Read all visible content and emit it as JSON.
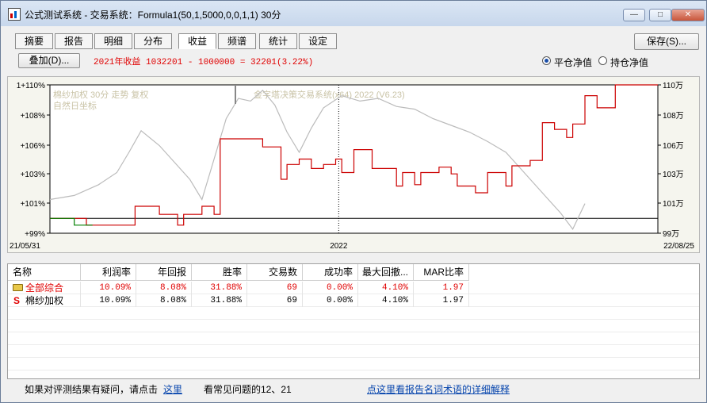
{
  "window": {
    "title": "公式测试系统 - 交易系统：Formula1(50,1,5000,0,0,1,1) 30分",
    "min_label": "—",
    "max_label": "□",
    "close_label": "✕"
  },
  "tabs": [
    {
      "label": "摘要"
    },
    {
      "label": "报告"
    },
    {
      "label": "明细"
    },
    {
      "label": "分布"
    },
    {
      "label": "收益"
    },
    {
      "label": "频谱"
    },
    {
      "label": "统计"
    },
    {
      "label": "设定"
    }
  ],
  "toolbar": {
    "save_label": "保存(S)...",
    "overlay_label": "叠加(D)...",
    "summary_text": "2021年收益 1032201 - 1000000 = 32201(3.22%)",
    "radio_close": "平仓净值",
    "radio_hold": "持仓净值"
  },
  "chart": {
    "legend_line1": "棉纱加权 30分 走势 复权",
    "legend_line2": "自然日坐标",
    "watermark": "金字塔决策交易系统(x64) 2022 (V6.23)",
    "x_labels": [
      "21/05/31",
      "2022",
      "22/08/25"
    ]
  },
  "chart_data": {
    "type": "line",
    "x_range": [
      "21/05/31",
      "22/08/25"
    ],
    "y_left_ticks": [
      "1+110%",
      "+108%",
      "+106%",
      "+103%",
      "+101%",
      "+99%"
    ],
    "y_right_ticks": [
      "110万",
      "108万",
      "106万",
      "103万",
      "101万",
      "99万"
    ],
    "series": [
      {
        "color": "#cc0000",
        "points": [
          [
            0,
            100.1
          ],
          [
            0.06,
            100.1
          ],
          [
            0.06,
            99.6
          ],
          [
            0.14,
            99.6
          ],
          [
            0.14,
            101
          ],
          [
            0.18,
            101
          ],
          [
            0.18,
            100.4
          ],
          [
            0.21,
            100.4
          ],
          [
            0.21,
            99.6
          ],
          [
            0.22,
            99.6
          ],
          [
            0.22,
            100.4
          ],
          [
            0.25,
            100.4
          ],
          [
            0.25,
            101
          ],
          [
            0.27,
            101
          ],
          [
            0.27,
            100.4
          ],
          [
            0.28,
            100.4
          ],
          [
            0.28,
            106
          ],
          [
            0.35,
            106
          ],
          [
            0.35,
            105.4
          ],
          [
            0.38,
            105.4
          ],
          [
            0.38,
            103
          ],
          [
            0.39,
            103
          ],
          [
            0.39,
            104.1
          ],
          [
            0.41,
            104.1
          ],
          [
            0.41,
            104.5
          ],
          [
            0.43,
            104.5
          ],
          [
            0.43,
            103.8
          ],
          [
            0.45,
            103.8
          ],
          [
            0.45,
            104.1
          ],
          [
            0.47,
            104.1
          ],
          [
            0.47,
            104.5
          ],
          [
            0.48,
            104.5
          ],
          [
            0.48,
            103.5
          ],
          [
            0.5,
            103.5
          ],
          [
            0.5,
            105.2
          ],
          [
            0.53,
            105.2
          ],
          [
            0.53,
            103.8
          ],
          [
            0.57,
            103.8
          ],
          [
            0.57,
            102.5
          ],
          [
            0.58,
            102.5
          ],
          [
            0.58,
            103.5
          ],
          [
            0.6,
            103.5
          ],
          [
            0.6,
            102.6
          ],
          [
            0.61,
            102.6
          ],
          [
            0.61,
            103.5
          ],
          [
            0.64,
            103.5
          ],
          [
            0.64,
            103.9
          ],
          [
            0.66,
            103.9
          ],
          [
            0.66,
            103.4
          ],
          [
            0.67,
            103.4
          ],
          [
            0.67,
            102.5
          ],
          [
            0.7,
            102.5
          ],
          [
            0.7,
            102.0
          ],
          [
            0.72,
            102.0
          ],
          [
            0.72,
            103.5
          ],
          [
            0.75,
            103.5
          ],
          [
            0.75,
            102.5
          ],
          [
            0.76,
            102.5
          ],
          [
            0.76,
            104
          ],
          [
            0.79,
            104
          ],
          [
            0.79,
            104.4
          ],
          [
            0.81,
            104.4
          ],
          [
            0.81,
            107.2
          ],
          [
            0.83,
            107.2
          ],
          [
            0.83,
            106.7
          ],
          [
            0.85,
            106.7
          ],
          [
            0.85,
            106.1
          ],
          [
            0.86,
            106.1
          ],
          [
            0.86,
            107.1
          ],
          [
            0.88,
            107.1
          ],
          [
            0.88,
            109.2
          ],
          [
            0.9,
            109.2
          ],
          [
            0.9,
            108.3
          ],
          [
            0.93,
            108.3
          ],
          [
            0.93,
            110
          ],
          [
            1,
            110
          ]
        ]
      },
      {
        "color": "#bbbbbb",
        "points": [
          [
            0,
            101.5
          ],
          [
            0.04,
            101.8
          ],
          [
            0.08,
            102.6
          ],
          [
            0.11,
            103.5
          ],
          [
            0.13,
            105.0
          ],
          [
            0.15,
            106.6
          ],
          [
            0.18,
            105.5
          ],
          [
            0.21,
            104.0
          ],
          [
            0.23,
            103.0
          ],
          [
            0.25,
            101.5
          ],
          [
            0.27,
            104.5
          ],
          [
            0.29,
            107.5
          ],
          [
            0.31,
            109.0
          ],
          [
            0.33,
            108.8
          ],
          [
            0.35,
            109.6
          ],
          [
            0.37,
            108.5
          ],
          [
            0.39,
            106.5
          ],
          [
            0.41,
            105.0
          ],
          [
            0.43,
            106.8
          ],
          [
            0.45,
            108.3
          ],
          [
            0.48,
            109.2
          ],
          [
            0.51,
            108.8
          ],
          [
            0.54,
            109.0
          ],
          [
            0.57,
            108.4
          ],
          [
            0.6,
            108.2
          ],
          [
            0.63,
            107.5
          ],
          [
            0.66,
            107.0
          ],
          [
            0.69,
            106.5
          ],
          [
            0.72,
            105.8
          ],
          [
            0.75,
            105.0
          ],
          [
            0.78,
            103.5
          ],
          [
            0.8,
            102.5
          ],
          [
            0.82,
            101.5
          ],
          [
            0.84,
            100.5
          ],
          [
            0.86,
            99.3
          ],
          [
            0.88,
            101.2
          ]
        ]
      },
      {
        "color": "#008000",
        "points": [
          [
            0,
            100.1
          ],
          [
            0.04,
            100.1
          ],
          [
            0.04,
            99.6
          ],
          [
            0.07,
            99.6
          ]
        ]
      }
    ],
    "grid": false
  },
  "table": {
    "headers": [
      "名称",
      "利润率",
      "年回报",
      "胜率",
      "交易数",
      "成功率",
      "最大回撤...",
      "MAR比率"
    ],
    "rows": [
      {
        "name": "全部综合",
        "cells": [
          "10.09%",
          "8.08%",
          "31.88%",
          "69",
          "0.00%",
          "4.10%",
          "1.97"
        ]
      },
      {
        "name": "棉纱加权",
        "cells": [
          "10.09%",
          "8.08%",
          "31.88%",
          "69",
          "0.00%",
          "4.10%",
          "1.97"
        ]
      }
    ],
    "row1_icon": "folder-icon",
    "row2_icon_text": "S"
  },
  "footer": {
    "text1": "如果对评测结果有疑问，请点击",
    "link1": "这里",
    "text2": "看常见问题的12、21",
    "link2": "点这里看报告名词术语的详细解释"
  }
}
